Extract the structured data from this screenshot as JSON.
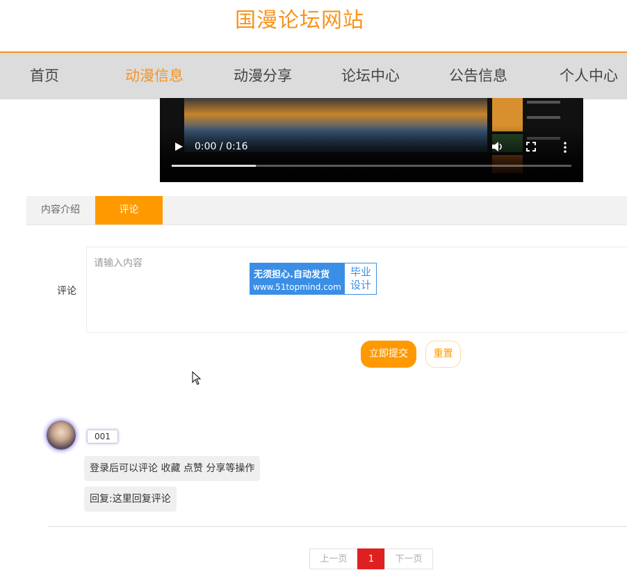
{
  "site": {
    "title": "国漫论坛网站"
  },
  "nav": {
    "items": [
      {
        "label": "首页"
      },
      {
        "label": "动漫信息",
        "active": true
      },
      {
        "label": "动漫分享"
      },
      {
        "label": "论坛中心"
      },
      {
        "label": "公告信息"
      },
      {
        "label": "个人中心"
      }
    ]
  },
  "video": {
    "time": "0:00 / 0:16",
    "progress_fraction": 0.21,
    "icons": [
      "play-icon",
      "volume-icon",
      "fullscreen-icon",
      "more-options-icon"
    ]
  },
  "tabs": [
    {
      "label": "内容介绍",
      "active": false
    },
    {
      "label": "评论",
      "active": true
    }
  ],
  "comment_form": {
    "label": "评论",
    "placeholder": "请输入内容",
    "submit_label": "立即提交",
    "reset_label": "重置"
  },
  "watermark": {
    "line1": "无须担心.自动发货",
    "line2": "www.51topmind.com",
    "side1": "毕业",
    "side2": "设计"
  },
  "comments": [
    {
      "username": "001",
      "content": "登录后可以评论 收藏 点赞 分享等操作",
      "reply": "回复:这里回复评论"
    }
  ],
  "pagination": {
    "prev": "上一页",
    "current": "1",
    "next": "下一页"
  },
  "colors": {
    "accent": "#f7931e",
    "tab_active": "#ff9900",
    "nav_bg": "#dcdcdc",
    "page_current": "#e02020"
  }
}
